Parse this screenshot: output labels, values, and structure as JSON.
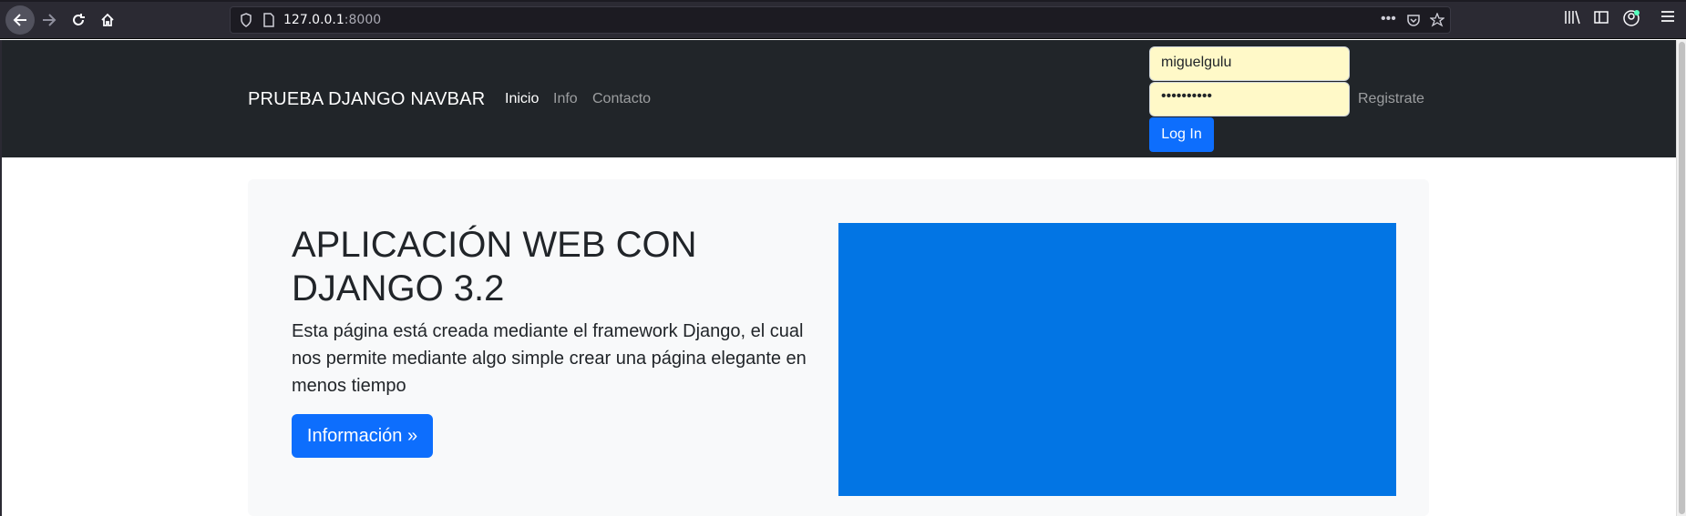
{
  "browser": {
    "url_host": "127.0.0.1",
    "url_port": ":8000"
  },
  "navbar": {
    "brand": "PRUEBA DJANGO NAVBAR",
    "links": [
      "Inicio",
      "Info",
      "Contacto"
    ],
    "username_value": "miguelgulu",
    "password_value": "••••••••••",
    "login_label": "Log In",
    "register_label": "Registrate"
  },
  "hero": {
    "title": "APLICACIÓN WEB CON DJANGO 3.2",
    "text": "Esta página está creada mediante el framework Django, el cual nos permite mediante algo simple crear una página elegante en menos tiempo",
    "button_label": "Información »"
  },
  "colors": {
    "navbar_bg": "#212529",
    "primary": "#0d6efd",
    "hero_block": "#0275e4"
  }
}
